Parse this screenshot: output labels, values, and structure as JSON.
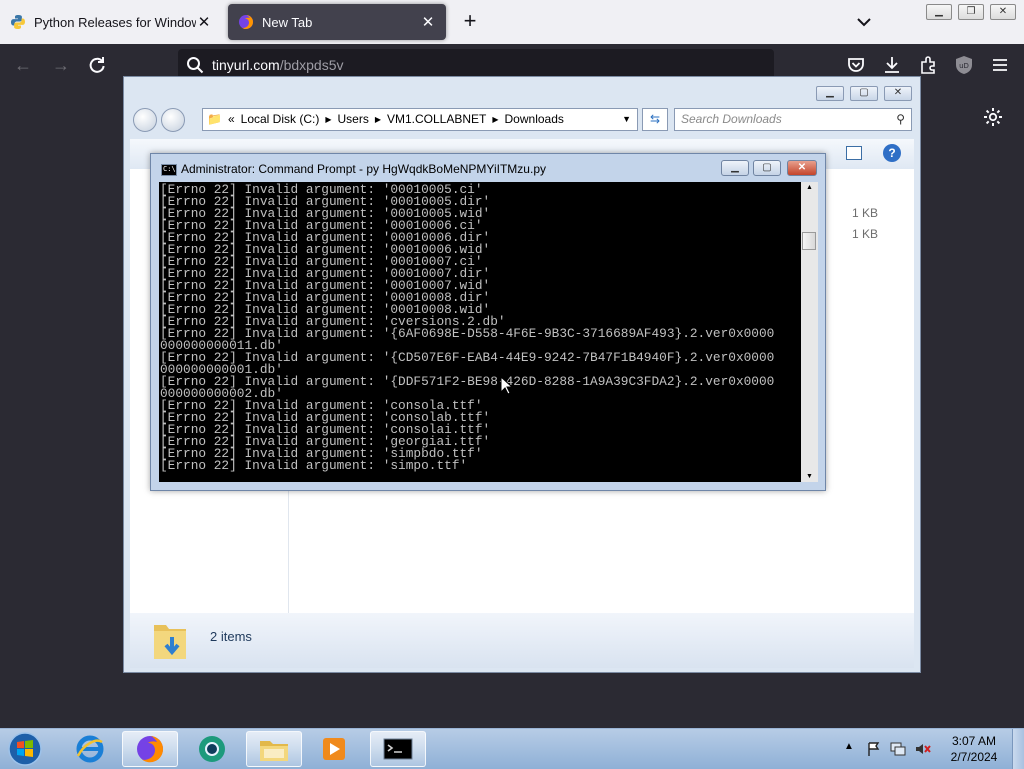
{
  "browser": {
    "tabs": [
      {
        "title": "Python Releases for Windows |",
        "active": false,
        "icon": "python-icon"
      },
      {
        "title": "New Tab",
        "active": true,
        "icon": "firefox-icon"
      }
    ],
    "url": {
      "host": "tinyurl.com",
      "path": "/bdxpds5v"
    }
  },
  "explorer": {
    "breadcrumb": {
      "overflow": "«",
      "items": [
        "Local Disk (C:)",
        "Users",
        "VM1.COLLABNET",
        "Downloads"
      ]
    },
    "search_placeholder": "Search Downloads",
    "file_sizes": [
      "1 KB",
      "1 KB"
    ],
    "status": {
      "items_count": "2 items"
    }
  },
  "cmd": {
    "title": "Administrator:  Command Prompt - py  HgWqdkBoMeNPMYiITMzu.py",
    "output": "[Errno 22] Invalid argument: '00010005.ci'\n[Errno 22] Invalid argument: '00010005.dir'\n[Errno 22] Invalid argument: '00010005.wid'\n[Errno 22] Invalid argument: '00010006.ci'\n[Errno 22] Invalid argument: '00010006.dir'\n[Errno 22] Invalid argument: '00010006.wid'\n[Errno 22] Invalid argument: '00010007.ci'\n[Errno 22] Invalid argument: '00010007.dir'\n[Errno 22] Invalid argument: '00010007.wid'\n[Errno 22] Invalid argument: '00010008.dir'\n[Errno 22] Invalid argument: '00010008.wid'\n[Errno 22] Invalid argument: 'cversions.2.db'\n[Errno 22] Invalid argument: '{6AF0698E-D558-4F6E-9B3C-3716689AF493}.2.ver0x0000\n000000000011.db'\n[Errno 22] Invalid argument: '{CD507E6F-EAB4-44E9-9242-7B47F1B4940F}.2.ver0x0000\n000000000001.db'\n[Errno 22] Invalid argument: '{DDF571F2-BE98-426D-8288-1A9A39C3FDA2}.2.ver0x0000\n000000000002.db'\n[Errno 22] Invalid argument: 'consola.ttf'\n[Errno 22] Invalid argument: 'consolab.ttf'\n[Errno 22] Invalid argument: 'consolai.ttf'\n[Errno 22] Invalid argument: 'georgiai.ttf'\n[Errno 22] Invalid argument: 'simpbdo.ttf'\n[Errno 22] Invalid argument: 'simpo.ttf'\n_"
  },
  "taskbar": {
    "apps": [
      "internet-explorer-icon",
      "firefox-icon",
      "chrome-style-icon",
      "file-explorer-icon",
      "media-player-icon",
      "command-prompt-icon"
    ],
    "clock": {
      "time": "3:07 AM",
      "date": "2/7/2024"
    }
  }
}
